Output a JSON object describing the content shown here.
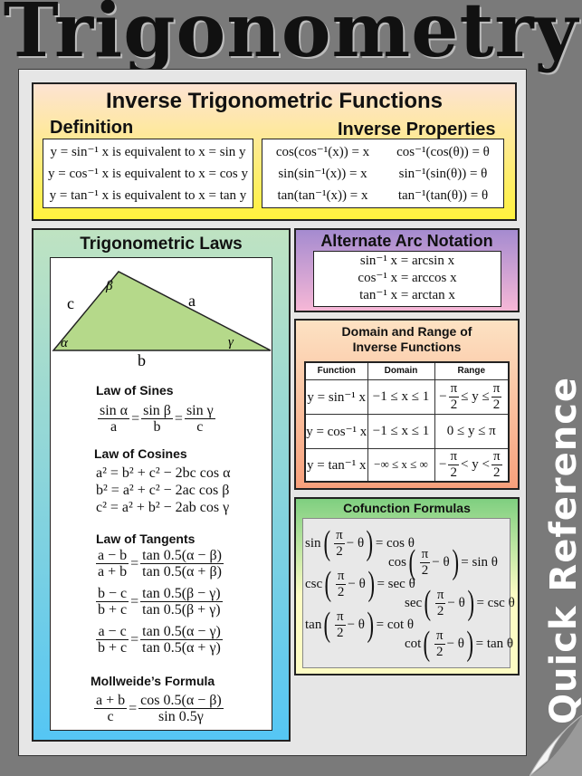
{
  "title": "Trigonometry",
  "side_label": "Quick Reference",
  "inverse": {
    "title": "Inverse Trigonometric Functions",
    "definition_heading": "Definition",
    "properties_heading": "Inverse Properties",
    "definitions": [
      "y = sin⁻¹ x  is equivalent to x = sin y",
      "y = cos⁻¹ x  is equivalent to x = cos y",
      "y = tan⁻¹ x  is equivalent to x = tan y"
    ],
    "properties": [
      [
        "cos(cos⁻¹(x)) = x",
        "cos⁻¹(cos(θ)) = θ"
      ],
      [
        "sin(sin⁻¹(x)) = x",
        "sin⁻¹(sin(θ)) = θ"
      ],
      [
        "tan(tan⁻¹(x)) = x",
        "tan⁻¹(tan(θ)) = θ"
      ]
    ]
  },
  "laws": {
    "title": "Trigonometric Laws",
    "triangle": {
      "c": "c",
      "a": "a",
      "b": "b",
      "alpha": "α",
      "beta": "β",
      "gamma": "γ",
      "fill": "#b5d98a"
    },
    "sines_heading": "Law of Sines",
    "sines": [
      {
        "n": "sin α",
        "d": "a"
      },
      "=",
      {
        "n": "sin β",
        "d": "b"
      },
      "=",
      {
        "n": "sin γ",
        "d": "c"
      }
    ],
    "cosines_heading": "Law of Cosines",
    "cosines": [
      "a² = b² + c² − 2bc cos α",
      "b² = a² + c² − 2ac cos β",
      "c² = a² + b² − 2ab cos γ"
    ],
    "tangents_heading": "Law of Tangents",
    "tangents": [
      [
        {
          "n": "a − b",
          "d": "a + b"
        },
        "=",
        {
          "n": "tan 0.5(α − β)",
          "d": "tan 0.5(α + β)"
        }
      ],
      [
        {
          "n": "b − c",
          "d": "b + c"
        },
        "=",
        {
          "n": "tan 0.5(β − γ)",
          "d": "tan 0.5(β + γ)"
        }
      ],
      [
        {
          "n": "a − c",
          "d": "b + c"
        },
        "=",
        {
          "n": "tan 0.5(α − γ)",
          "d": "tan 0.5(α + γ)"
        }
      ]
    ],
    "mollweide_heading": "Mollweide’s Formula",
    "mollweide": [
      {
        "n": "a + b",
        "d": "c"
      },
      "=",
      {
        "n": "cos 0.5(α − β)",
        "d": "sin 0.5γ"
      }
    ]
  },
  "arc": {
    "title": "Alternate Arc Notation",
    "lines": [
      "sin⁻¹ x = arcsin x",
      "cos⁻¹ x = arccos x",
      "tan⁻¹ x = arctan x"
    ]
  },
  "domain": {
    "title_1": "Domain and Range of",
    "title_2": "Inverse Functions",
    "headers": [
      "Function",
      "Domain",
      "Range"
    ],
    "rows": [
      [
        "y = sin⁻¹ x",
        "−1 ≤ x ≤ 1",
        [
          "−",
          {
            "n": "π",
            "d": "2"
          },
          "≤ y ≤",
          {
            "n": "π",
            "d": "2"
          }
        ]
      ],
      [
        "y = cos⁻¹ x",
        "−1 ≤ x ≤ 1",
        [
          "0 ≤ y ≤ π"
        ]
      ],
      [
        "y = tan⁻¹ x",
        "−∞ ≤ x ≤ ∞",
        [
          "−",
          {
            "n": "π",
            "d": "2"
          },
          "< y <",
          {
            "n": "π",
            "d": "2"
          }
        ]
      ]
    ]
  },
  "cofunction": {
    "title": "Cofunction Formulas",
    "left": [
      [
        "sin",
        {
          "paren": [
            {
              "n": "π",
              "d": "2"
            },
            "− θ"
          ]
        },
        "= cos θ"
      ],
      [
        "csc",
        {
          "paren": [
            {
              "n": "π",
              "d": "2"
            },
            "− θ"
          ]
        },
        "= sec θ"
      ],
      [
        "tan",
        {
          "paren": [
            {
              "n": "π",
              "d": "2"
            },
            "− θ"
          ]
        },
        "= cot θ"
      ]
    ],
    "right": [
      [
        "cos",
        {
          "paren": [
            {
              "n": "π",
              "d": "2"
            },
            "− θ"
          ]
        },
        "= sin θ"
      ],
      [
        "sec",
        {
          "paren": [
            {
              "n": "π",
              "d": "2"
            },
            "− θ"
          ]
        },
        "= csc θ"
      ],
      [
        "cot",
        {
          "paren": [
            {
              "n": "π",
              "d": "2"
            },
            "− θ"
          ]
        },
        "= tan θ"
      ]
    ]
  }
}
